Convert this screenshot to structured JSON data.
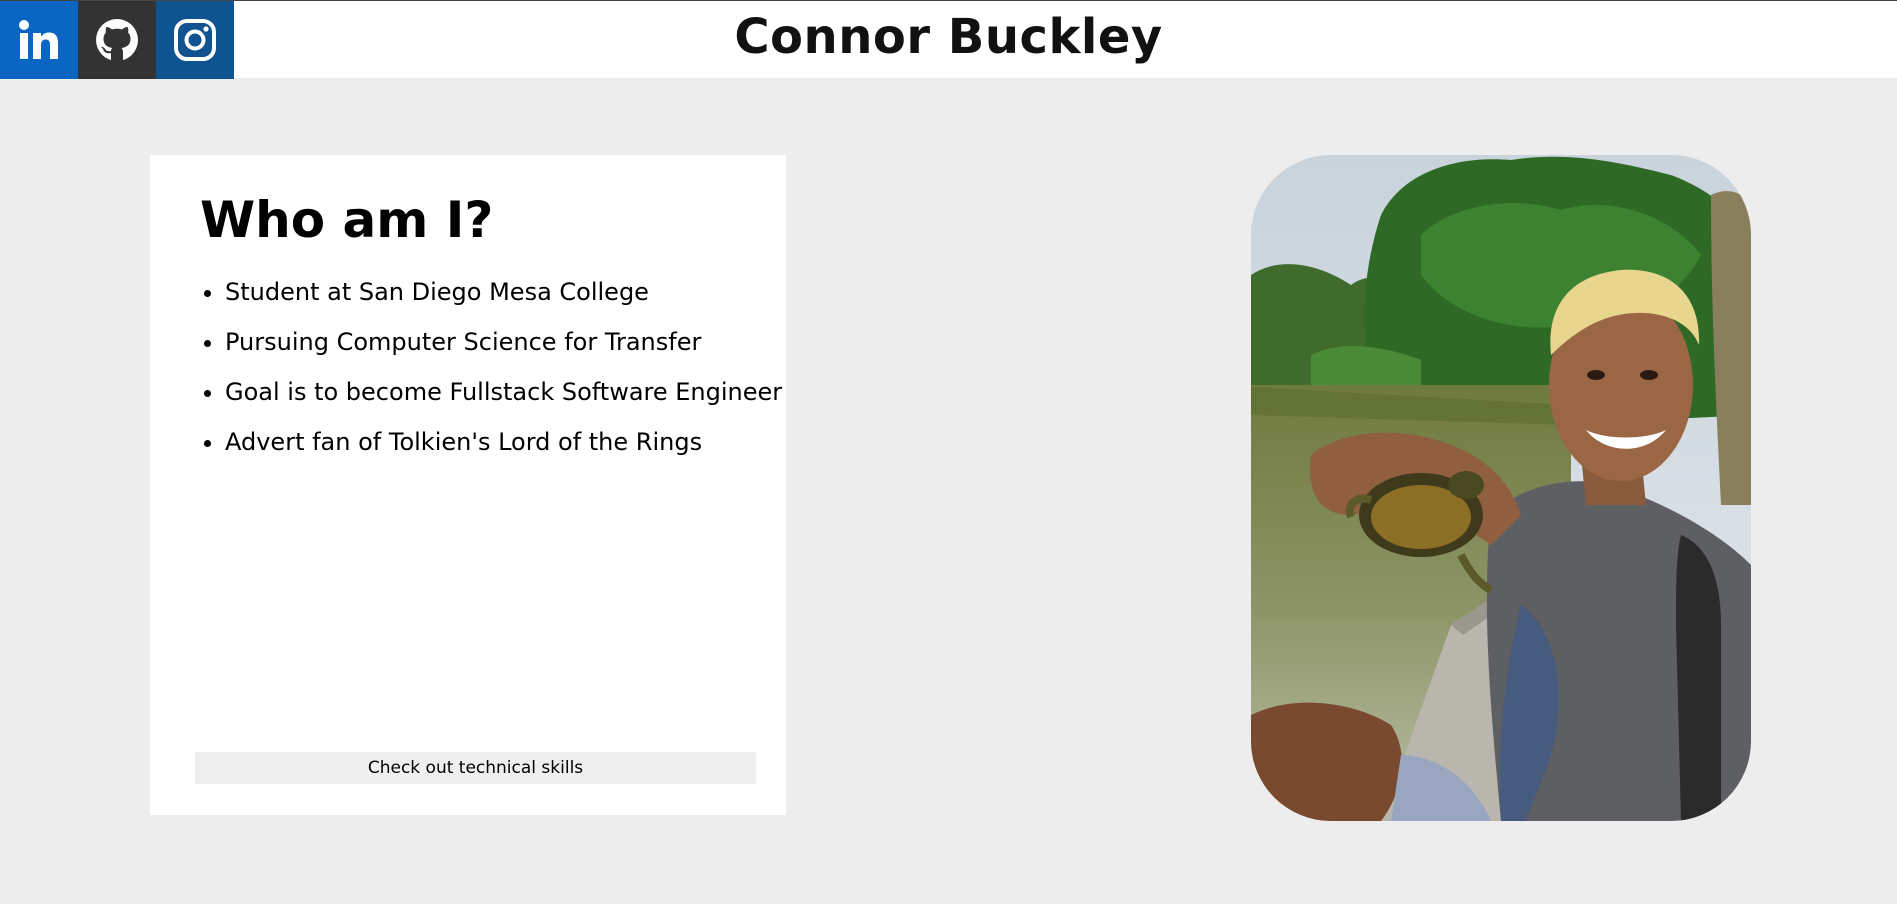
{
  "header": {
    "title": "Connor Buckley",
    "social": [
      {
        "name": "linkedin",
        "label": "LinkedIn",
        "color": "#0a66c2"
      },
      {
        "name": "github",
        "label": "GitHub",
        "color": "#333333"
      },
      {
        "name": "instagram",
        "label": "Instagram",
        "color": "#0f5390"
      }
    ]
  },
  "about": {
    "heading": "Who am I?",
    "items": [
      "Student at San Diego Mesa College",
      "Pursuing Computer Science for Transfer",
      "Goal is to become Fullstack Software Engineer",
      "Advert fan of Tolkien's Lord of the Rings"
    ],
    "button_label": "Check out technical skills"
  },
  "colors": {
    "page_bg": "#ededed",
    "card_bg": "#ffffff",
    "button_bg": "#efefef"
  }
}
